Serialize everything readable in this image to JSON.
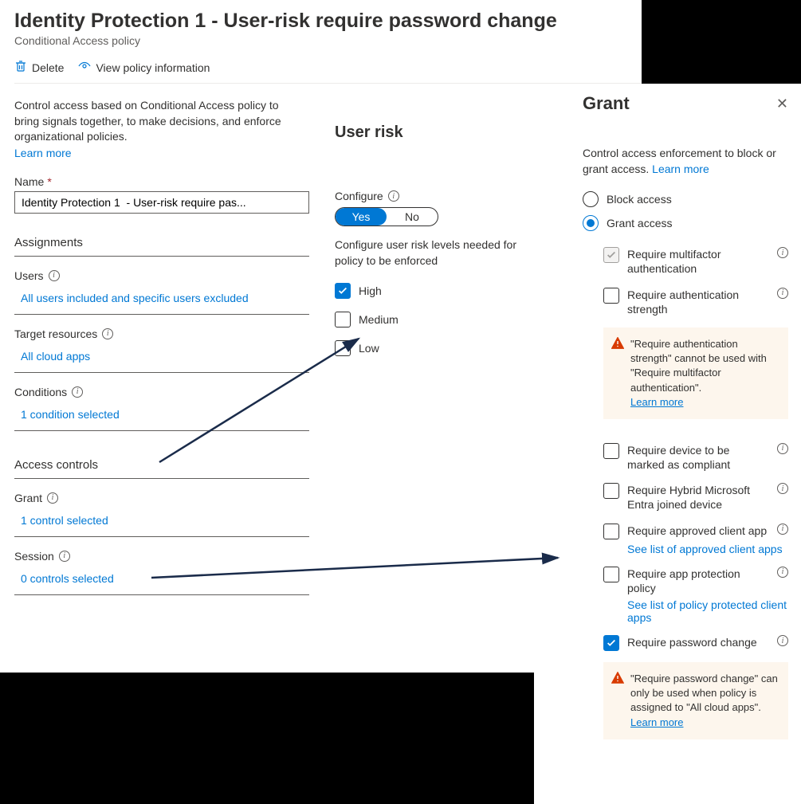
{
  "header": {
    "title": "Identity Protection 1 - User-risk require password change",
    "subtitle": "Conditional Access policy",
    "delete": "Delete",
    "view_info": "View policy information"
  },
  "intro": {
    "text": "Control access based on Conditional Access policy to bring signals together, to make decisions, and enforce organizational policies.",
    "learn": "Learn more"
  },
  "name_field": {
    "label": "Name",
    "value": "Identity Protection 1  - User-risk require pas..."
  },
  "assignments": {
    "title": "Assignments",
    "users_label": "Users",
    "users_value": "All users included and specific users excluded",
    "target_label": "Target resources",
    "target_value": "All cloud apps",
    "conditions_label": "Conditions",
    "conditions_value": "1 condition selected"
  },
  "access_controls": {
    "title": "Access controls",
    "grant_label": "Grant",
    "grant_value": "1 control selected",
    "session_label": "Session",
    "session_value": "0 controls selected"
  },
  "user_risk": {
    "title": "User risk",
    "configure": "Configure",
    "yes": "Yes",
    "no": "No",
    "helper": "Configure user risk levels needed for policy to be enforced",
    "high": "High",
    "medium": "Medium",
    "low": "Low"
  },
  "grant": {
    "title": "Grant",
    "desc": "Control access enforcement to block or grant access.",
    "learn": "Learn more",
    "block": "Block access",
    "allow": "Grant access",
    "mfa": "Require multifactor authentication",
    "auth_strength": "Require authentication strength",
    "warn1": "\"Require authentication strength\" cannot be used with \"Require multifactor authentication\".",
    "warn_learn": "Learn more",
    "compliant": "Require device to be marked as compliant",
    "hybrid": "Require Hybrid Microsoft Entra joined device",
    "approved_app": "Require approved client app",
    "approved_link": "See list of approved client apps",
    "protection": "Require app protection policy",
    "protection_link": "See list of policy protected client apps",
    "pwd_change": "Require password change",
    "warn2": "\"Require password change\" can only be used when policy is assigned to \"All cloud apps\".",
    "warn2_learn": "Learn more"
  }
}
